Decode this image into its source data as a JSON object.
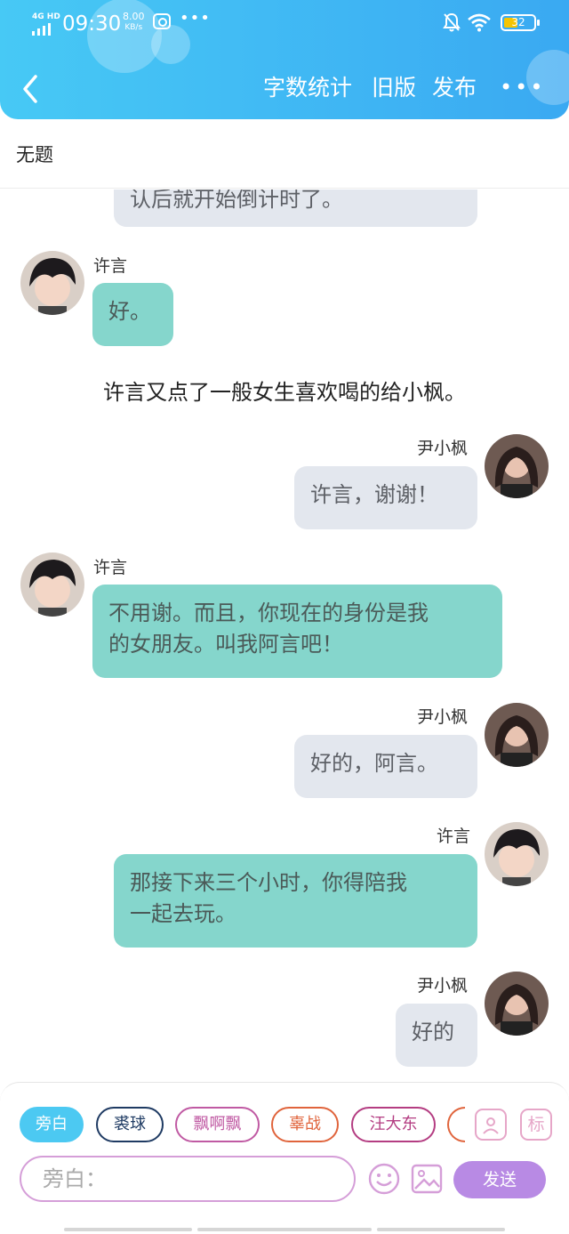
{
  "status_bar": {
    "network": "4G HD",
    "time": "09:30",
    "speed_value": "8.00",
    "speed_unit": "KB/s",
    "overflow": "•••",
    "battery": "32"
  },
  "header": {
    "back_icon": "chevron-left-icon",
    "word_count": "字数统计",
    "old_version": "旧版",
    "publish": "发布",
    "more": "•••"
  },
  "doc": {
    "title": "无题"
  },
  "chat": {
    "messages": [
      {
        "kind": "bubble",
        "side": "left-cut",
        "text": "认后就开始倒计时了。"
      },
      {
        "kind": "bubble",
        "side": "left",
        "name": "许言",
        "text": "好。"
      },
      {
        "kind": "narration",
        "text": "许言又点了一般女生喜欢喝的给小枫。"
      },
      {
        "kind": "bubble",
        "side": "right",
        "name": "尹小枫",
        "text": "许言，谢谢！"
      },
      {
        "kind": "bubble",
        "side": "left",
        "name": "许言",
        "text_line1": "不用谢。而且，你现在的身份是我",
        "text_line2": "的女朋友。叫我阿言吧！"
      },
      {
        "kind": "bubble",
        "side": "right",
        "name": "尹小枫",
        "text": "好的，阿言。"
      },
      {
        "kind": "bubble",
        "side": "right",
        "name": "许言",
        "text_line1": "那接下来三个小时，你得陪我",
        "text_line2": "一起去玩。"
      },
      {
        "kind": "bubble",
        "side": "right",
        "name": "尹小枫",
        "text": "好的"
      }
    ]
  },
  "composer": {
    "chips": [
      "旁白",
      "裘球",
      "飘啊飘",
      "辜战",
      "汪大东"
    ],
    "role_icon": "user-card-icon",
    "tag_label": "标",
    "placeholder": "旁白：",
    "emoji_icon": "smile-icon",
    "image_icon": "image-icon",
    "send": "发送"
  },
  "colors": {
    "header": "#3aa9f2",
    "teal_bubble": "#85d6cc",
    "grey_bubble": "#e3e7ee",
    "send": "#b88ae4"
  }
}
